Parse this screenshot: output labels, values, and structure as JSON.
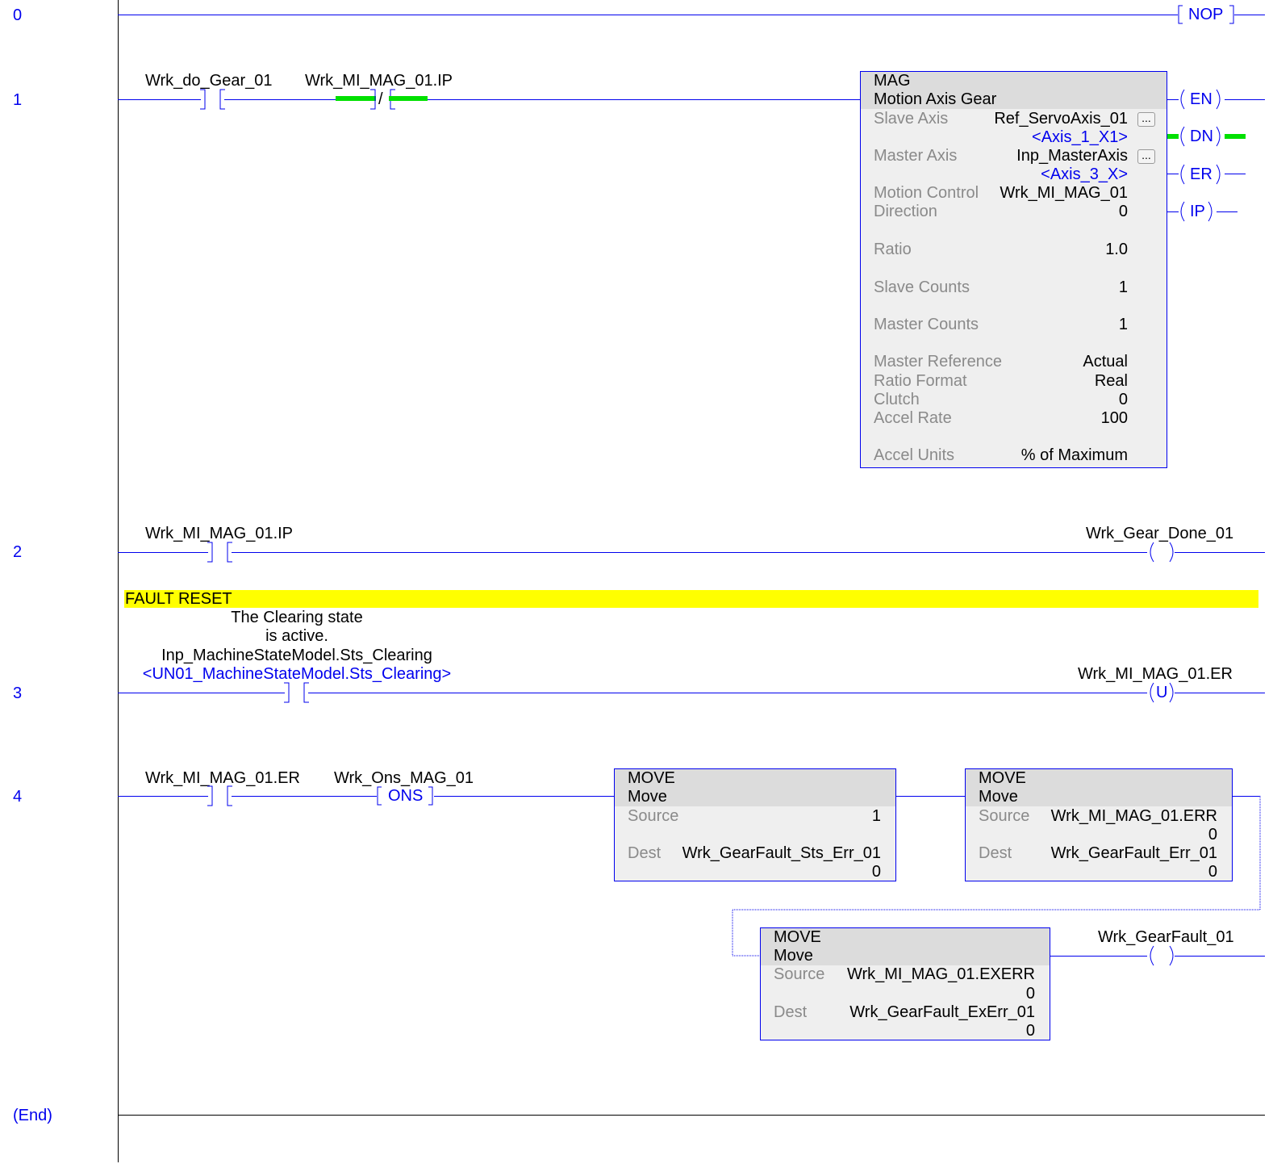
{
  "rung_numbers": [
    "0",
    "1",
    "2",
    "3",
    "4",
    "(End)"
  ],
  "rung0": {
    "nop_label": "NOP"
  },
  "rung1": {
    "contact1_tag": "Wrk_do_Gear_01",
    "contact2_tag": "Wrk_MI_MAG_01.IP",
    "contact2_symbol": "/",
    "mag": {
      "title": "MAG",
      "subtitle": "Motion Axis Gear",
      "slave_axis_label": "Slave Axis",
      "slave_axis_value": "Ref_ServoAxis_01",
      "slave_axis_alias": "<Axis_1_X1>",
      "master_axis_label": "Master Axis",
      "master_axis_value": "Inp_MasterAxis",
      "master_axis_alias": "<Axis_3_X>",
      "motion_control_label": "Motion Control",
      "motion_control_value": "Wrk_MI_MAG_01",
      "direction_label": "Direction",
      "direction_value": "0",
      "ratio_label": "Ratio",
      "ratio_value": "1.0",
      "slave_counts_label": "Slave Counts",
      "slave_counts_value": "1",
      "master_counts_label": "Master Counts",
      "master_counts_value": "1",
      "master_reference_label": "Master Reference",
      "master_reference_value": "Actual",
      "ratio_format_label": "Ratio Format",
      "ratio_format_value": "Real",
      "clutch_label": "Clutch",
      "clutch_value": "0",
      "accel_rate_label": "Accel Rate",
      "accel_rate_value": "100",
      "accel_units_label": "Accel Units",
      "accel_units_value": "% of Maximum",
      "ellipsis": "..."
    },
    "outputs": [
      "EN",
      "DN",
      "ER",
      "IP"
    ]
  },
  "rung2": {
    "contact_tag": "Wrk_MI_MAG_01.IP",
    "coil_tag": "Wrk_Gear_Done_01"
  },
  "rung3": {
    "comment_title": "FAULT RESET",
    "description_line1": "The Clearing state",
    "description_line2": "is active.",
    "contact_tag": "Inp_MachineStateModel.Sts_Clearing",
    "contact_alias": "<UN01_MachineStateModel.Sts_Clearing>",
    "coil_tag": "Wrk_MI_MAG_01.ER",
    "coil_letter": "U"
  },
  "rung4": {
    "contact_tag": "Wrk_MI_MAG_01.ER",
    "ons_tag": "Wrk_Ons_MAG_01",
    "ons_label": "ONS",
    "move1": {
      "title": "MOVE",
      "subtitle": "Move",
      "source_label": "Source",
      "source_value": "1",
      "dest_label": "Dest",
      "dest_value": "Wrk_GearFault_Sts_Err_01",
      "dest_num": "0"
    },
    "move2": {
      "title": "MOVE",
      "subtitle": "Move",
      "source_label": "Source",
      "source_value": "Wrk_MI_MAG_01.ERR",
      "source_num": "0",
      "dest_label": "Dest",
      "dest_value": "Wrk_GearFault_Err_01",
      "dest_num": "0"
    },
    "move3": {
      "title": "MOVE",
      "subtitle": "Move",
      "source_label": "Source",
      "source_value": "Wrk_MI_MAG_01.EXERR",
      "source_num": "0",
      "dest_label": "Dest",
      "dest_value": "Wrk_GearFault_ExErr_01",
      "dest_num": "0"
    },
    "coil_tag": "Wrk_GearFault_01"
  }
}
